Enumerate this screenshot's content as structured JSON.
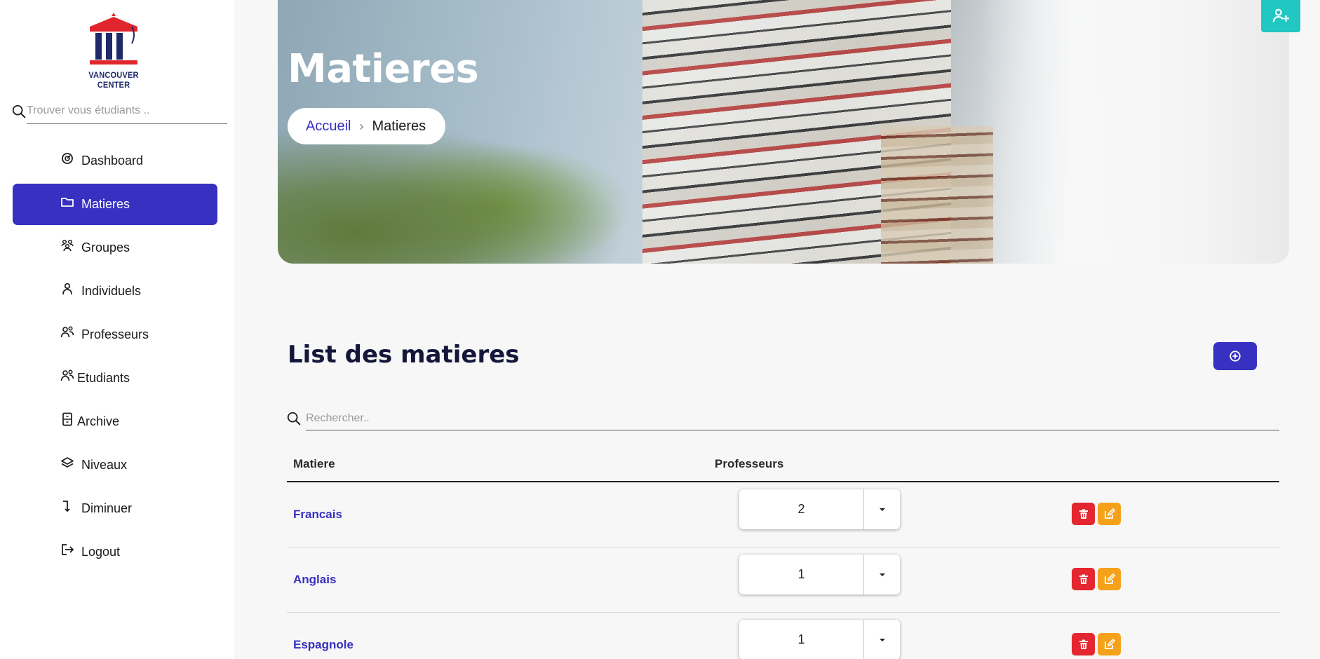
{
  "brand": {
    "name": "VANCOUVER CENTER"
  },
  "sidebar": {
    "search_placeholder": "Trouver vous étudiants ..",
    "items": [
      {
        "label": "Dashboard",
        "icon": "dashboard-icon"
      },
      {
        "label": "Matieres",
        "icon": "folder-icon",
        "active": true
      },
      {
        "label": "Groupes",
        "icon": "group-icon"
      },
      {
        "label": "Individuels",
        "icon": "person-icon"
      },
      {
        "label": "Professeurs",
        "icon": "people-icon"
      },
      {
        "label": "Etudiants",
        "icon": "people-icon"
      },
      {
        "label": "Archive",
        "icon": "archive-icon"
      },
      {
        "label": "Niveaux",
        "icon": "layers-icon"
      },
      {
        "label": "Diminuer",
        "icon": "arrow-down-icon"
      },
      {
        "label": "Logout",
        "icon": "logout-icon"
      }
    ]
  },
  "hero": {
    "title": "Matieres",
    "breadcrumb": {
      "home": "Accueil",
      "current": "Matieres"
    }
  },
  "list": {
    "title": "List des matieres",
    "search_placeholder": "Rechercher..",
    "columns": [
      "Matiere",
      "Professeurs"
    ],
    "rows": [
      {
        "name": "Francais",
        "professeurs": "2"
      },
      {
        "name": "Anglais",
        "professeurs": "1"
      },
      {
        "name": "Espagnole",
        "professeurs": "1"
      }
    ]
  },
  "colors": {
    "accent": "#3730c0",
    "teal": "#21c7c3",
    "danger": "#e3262f",
    "warning": "#f5a11a"
  }
}
